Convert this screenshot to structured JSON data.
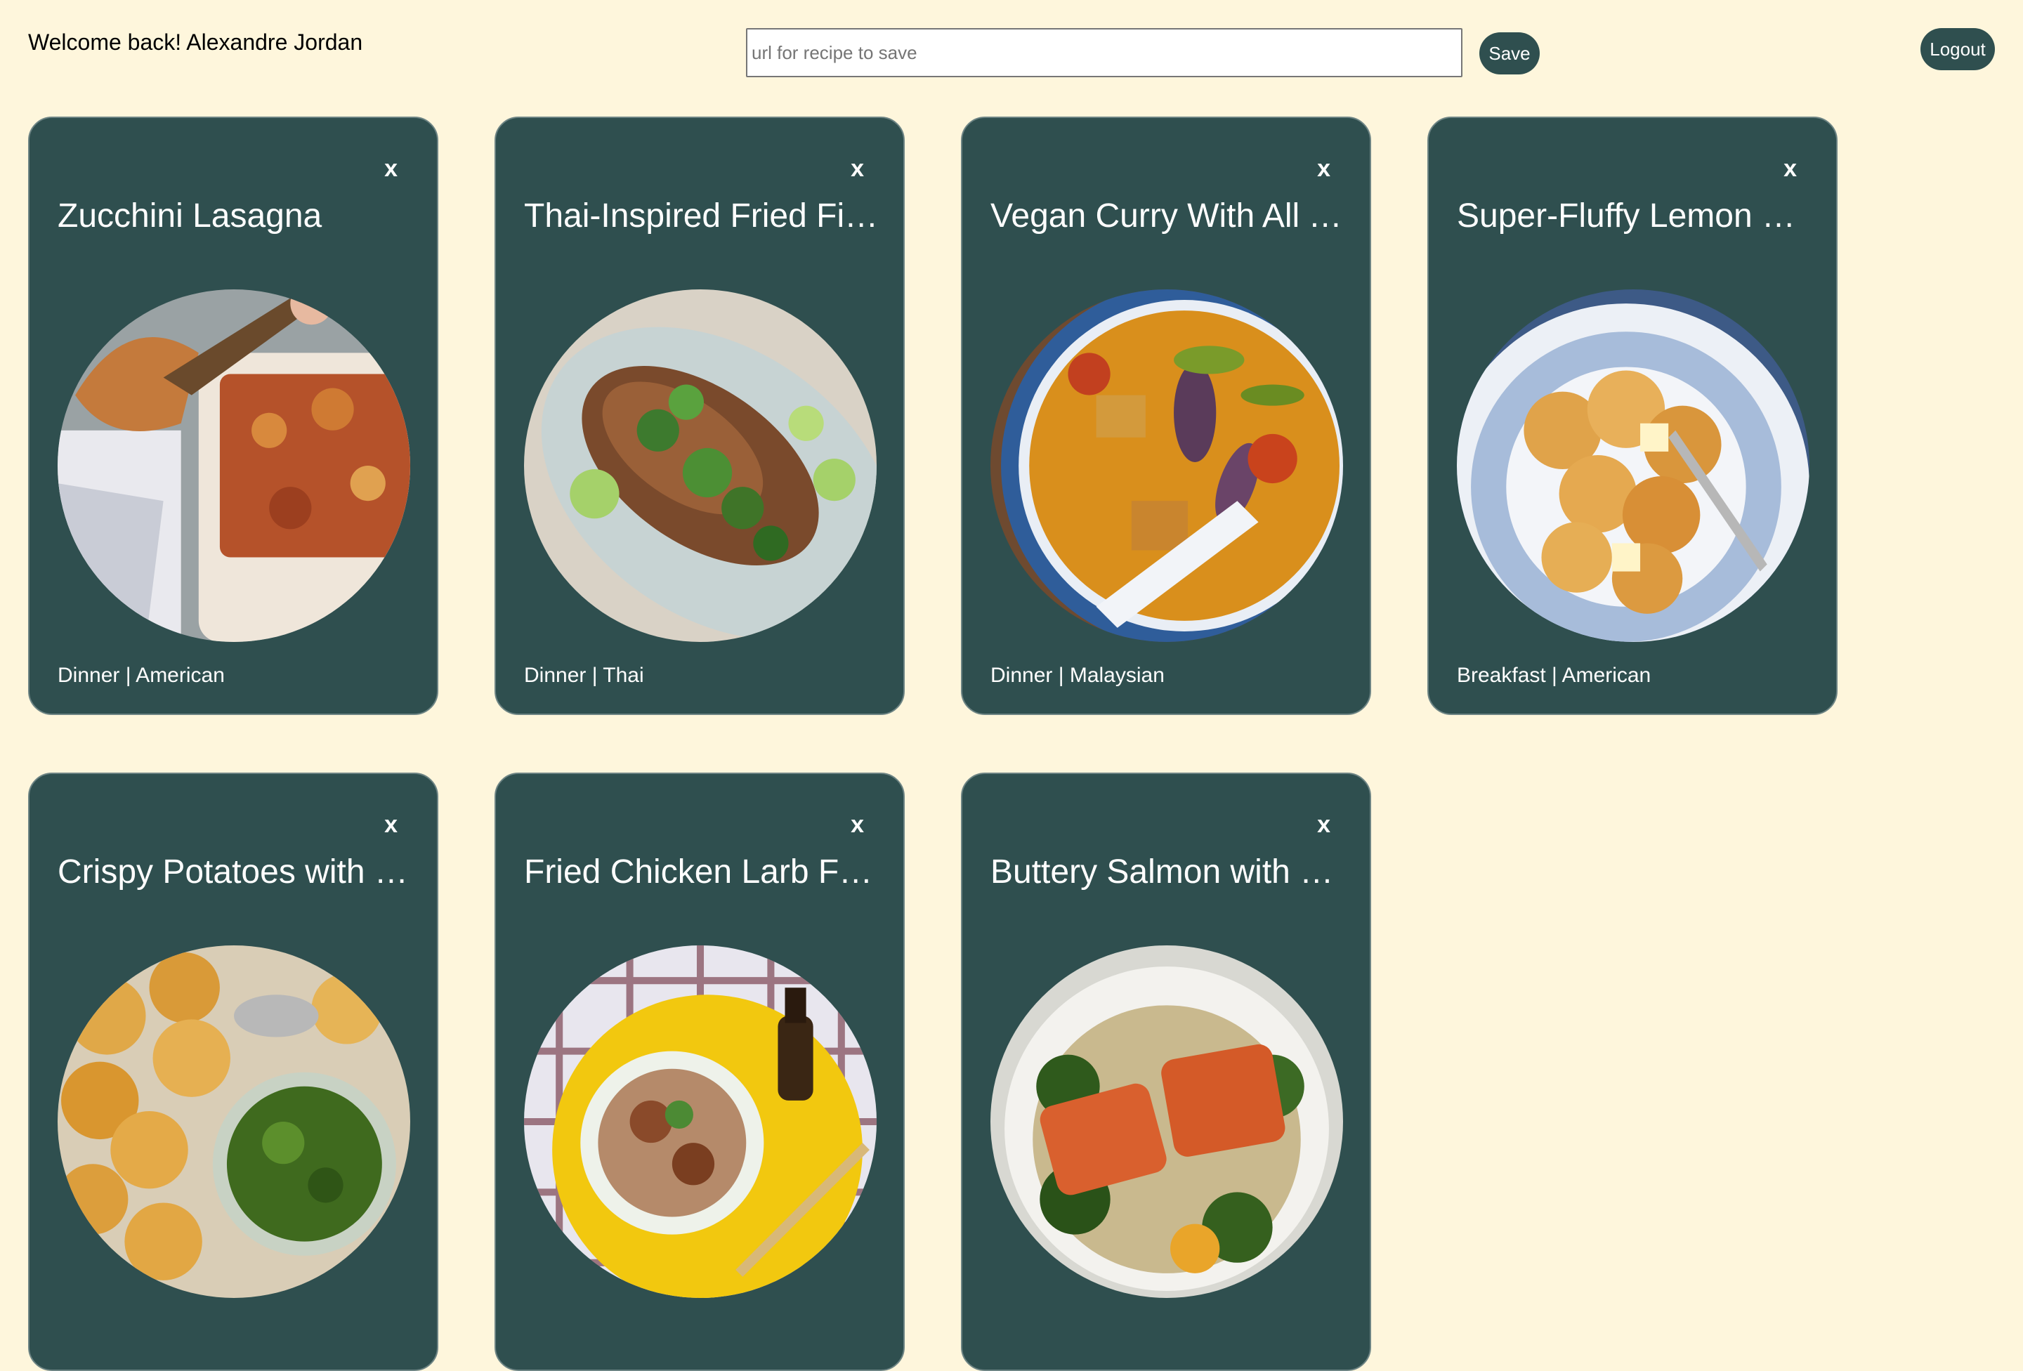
{
  "header": {
    "welcome_text": "Welcome back! Alexandre Jordan",
    "url_placeholder": "url for recipe to save",
    "save_label": "Save",
    "logout_label": "Logout"
  },
  "cards": [
    {
      "title": "Zucchini Lasagna",
      "close_label": "x",
      "meta": "Dinner | American",
      "image": "zucchini-lasagna-photo"
    },
    {
      "title": "Thai-Inspired Fried Fish",
      "close_label": "x",
      "meta": "Dinner | Thai",
      "image": "fried-fish-photo"
    },
    {
      "title": "Vegan Curry With All The Vegetables",
      "close_label": "x",
      "meta": "Dinner | Malaysian",
      "image": "vegan-curry-photo"
    },
    {
      "title": "Super-Fluffy Lemon Ricotta Pancakes",
      "close_label": "x",
      "meta": "Breakfast | American",
      "image": "lemon-pancakes-photo"
    },
    {
      "title": "Crispy Potatoes with Green Sauce",
      "close_label": "x",
      "meta": "",
      "image": "crispy-potatoes-photo"
    },
    {
      "title": "Fried Chicken Larb Fried Rice",
      "close_label": "x",
      "meta": "",
      "image": "chicken-larb-photo"
    },
    {
      "title": "Buttery Salmon with Greens",
      "close_label": "x",
      "meta": "",
      "image": "buttery-salmon-photo"
    }
  ],
  "colors": {
    "background": "#fef6dc",
    "card": "#2f4f4f",
    "button": "#2f4f4f"
  }
}
